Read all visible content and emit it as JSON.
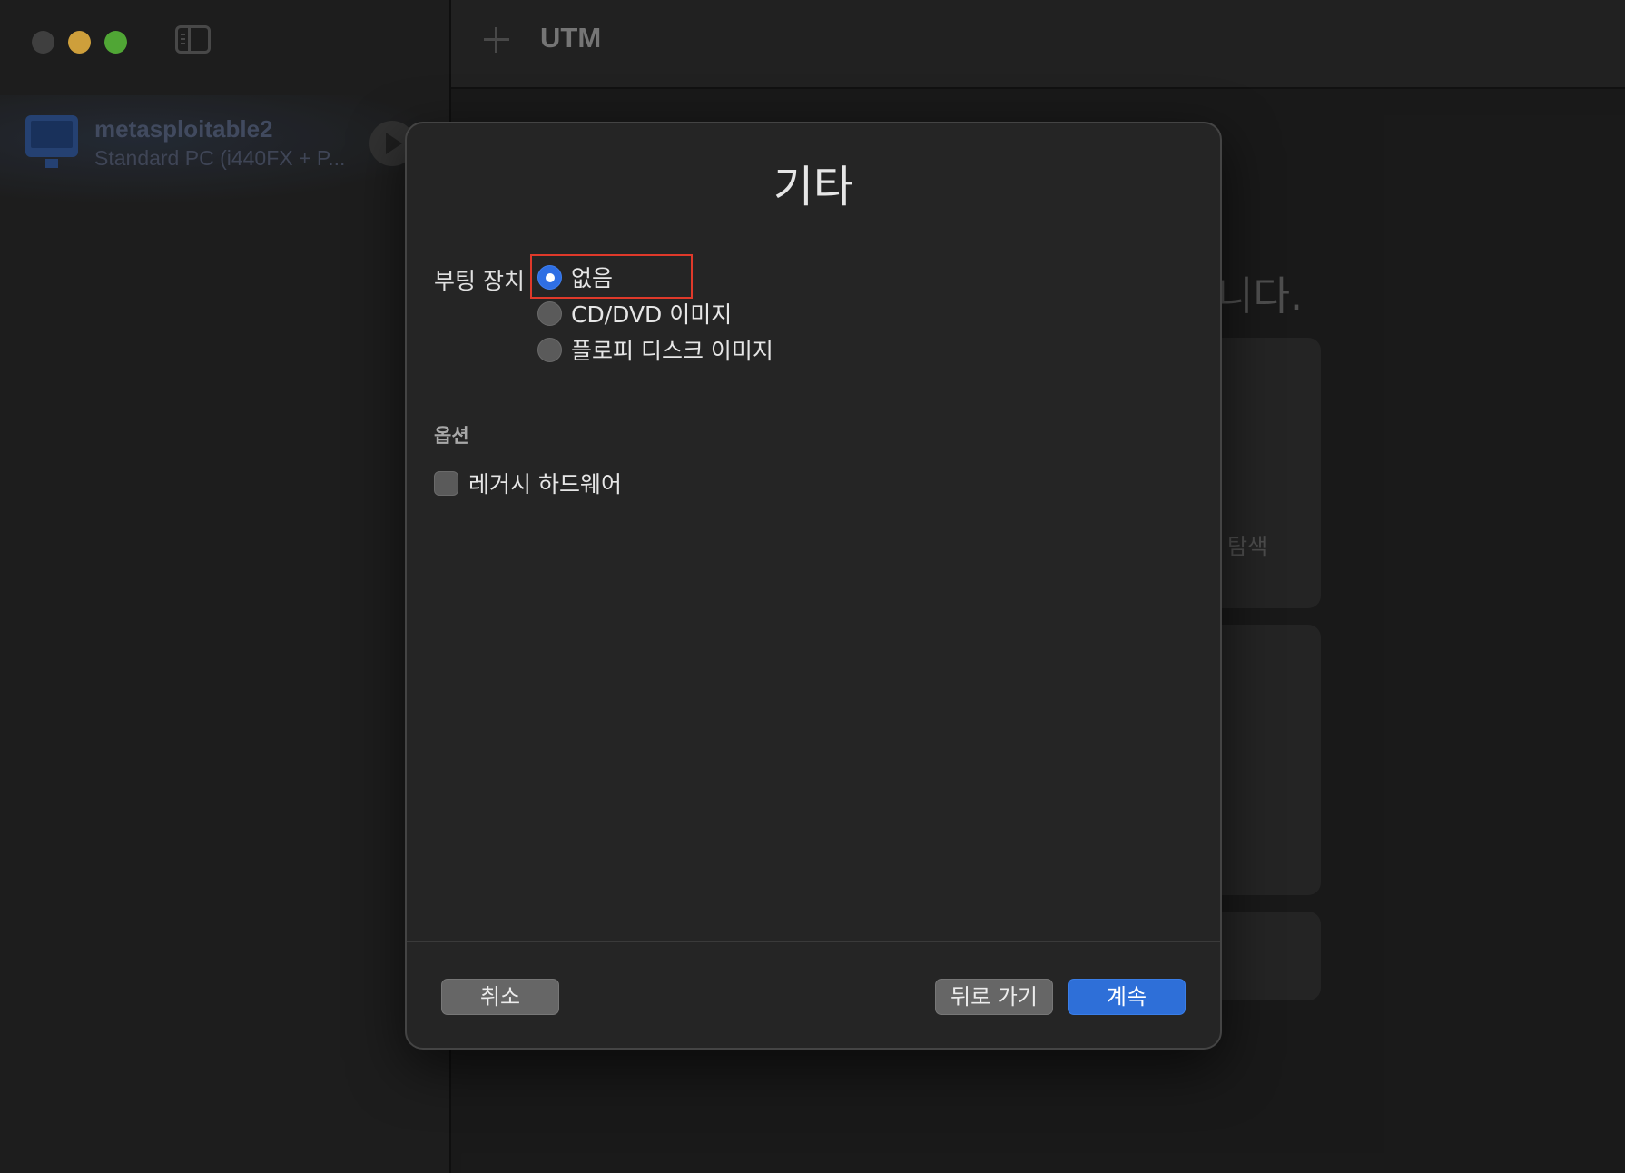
{
  "window": {
    "app_title": "UTM"
  },
  "sidebar": {
    "vm": {
      "name": "metasploitable2",
      "description": "Standard PC (i440FX + P..."
    }
  },
  "background": {
    "heading_tail": "니다.",
    "card_label": "탐색"
  },
  "dialog": {
    "title": "기타",
    "boot_device_label": "부팅 장치",
    "boot_options": [
      {
        "label": "없음",
        "selected": true
      },
      {
        "label": "CD/DVD 이미지",
        "selected": false
      },
      {
        "label": "플로피 디스크 이미지",
        "selected": false
      }
    ],
    "options_section_label": "옵션",
    "legacy_hardware_label": "레거시 하드웨어",
    "legacy_hardware_checked": false,
    "buttons": {
      "cancel": "취소",
      "back": "뒤로 가기",
      "continue": "계속"
    }
  },
  "colors": {
    "accent": "#2e6fd8",
    "highlight_box": "#e0392a",
    "traffic_min": "#f2bb46",
    "traffic_max": "#5ec33f"
  }
}
